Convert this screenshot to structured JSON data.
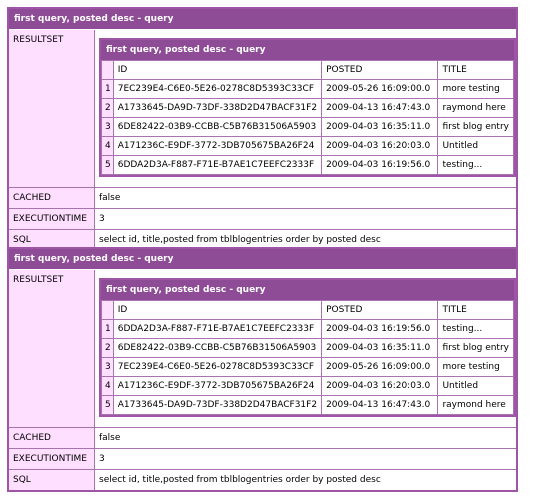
{
  "dumps": [
    {
      "title": "first query, posted desc - query",
      "resultset_label": "RESULTSET",
      "inner_title": "first query, posted desc - query",
      "columns": [
        "ID",
        "POSTED",
        "TITLE"
      ],
      "rows": [
        {
          "n": "1",
          "id": "7EC239E4-C6E0-5E26-0278C8D5393C33CF",
          "posted": "2009-05-26 16:09:00.0",
          "title": "more testing"
        },
        {
          "n": "2",
          "id": "A1733645-DA9D-73DF-338D2D47BACF31F2",
          "posted": "2009-04-13 16:47:43.0",
          "title": "raymond here"
        },
        {
          "n": "3",
          "id": "6DE82422-03B9-CCBB-C5B76B31506A5903",
          "posted": "2009-04-03 16:35:11.0",
          "title": "first blog entry"
        },
        {
          "n": "4",
          "id": "A171236C-E9DF-3772-3DB705675BA26F24",
          "posted": "2009-04-03 16:20:03.0",
          "title": "Untitled"
        },
        {
          "n": "5",
          "id": "6DDA2D3A-F887-F71E-B7AE1C7EEFC2333F",
          "posted": "2009-04-03 16:19:56.0",
          "title": "testing..."
        }
      ],
      "cached_label": "CACHED",
      "cached_value": "false",
      "exec_label": "EXECUTIONTIME",
      "exec_value": "3",
      "sql_label": "SQL",
      "sql_value": "select id, title,posted from tblblogentries order by posted desc"
    },
    {
      "title": "first query, posted desc - query",
      "resultset_label": "RESULTSET",
      "inner_title": "first query, posted desc - query",
      "columns": [
        "ID",
        "POSTED",
        "TITLE"
      ],
      "rows": [
        {
          "n": "1",
          "id": "6DDA2D3A-F887-F71E-B7AE1C7EEFC2333F",
          "posted": "2009-04-03 16:19:56.0",
          "title": "testing..."
        },
        {
          "n": "2",
          "id": "6DE82422-03B9-CCBB-C5B76B31506A5903",
          "posted": "2009-04-03 16:35:11.0",
          "title": "first blog entry"
        },
        {
          "n": "3",
          "id": "7EC239E4-C6E0-5E26-0278C8D5393C33CF",
          "posted": "2009-05-26 16:09:00.0",
          "title": "more testing"
        },
        {
          "n": "4",
          "id": "A171236C-E9DF-3772-3DB705675BA26F24",
          "posted": "2009-04-03 16:20:03.0",
          "title": "Untitled"
        },
        {
          "n": "5",
          "id": "A1733645-DA9D-73DF-338D2D47BACF31F2",
          "posted": "2009-04-13 16:47:43.0",
          "title": "raymond here"
        }
      ],
      "cached_label": "CACHED",
      "cached_value": "false",
      "exec_label": "EXECUTIONTIME",
      "exec_value": "3",
      "sql_label": "SQL",
      "sql_value": "select id, title,posted from tblblogentries order by posted desc"
    }
  ]
}
